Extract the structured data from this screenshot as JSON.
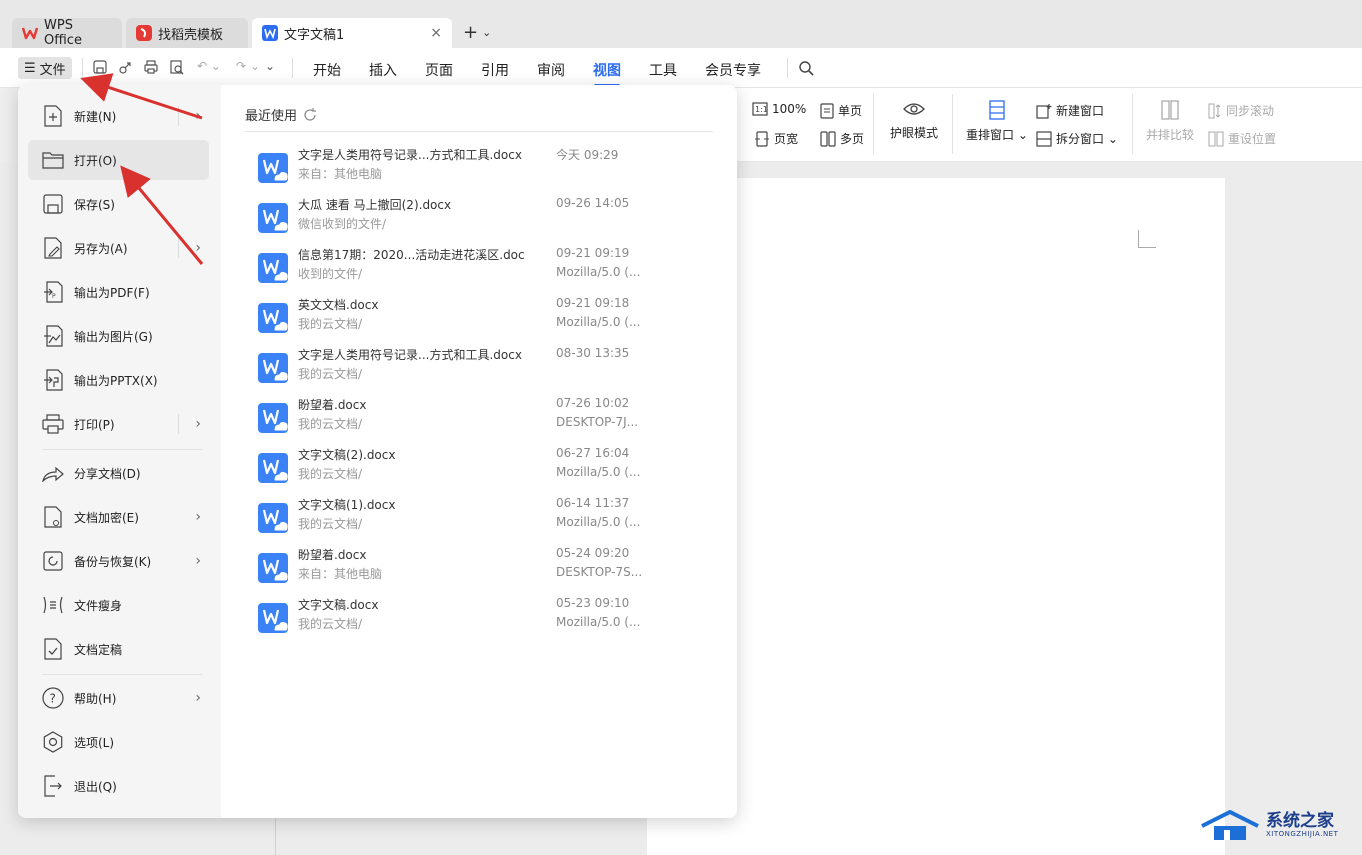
{
  "tabs": {
    "wps_label": "WPS Office",
    "template_label": "找稻壳模板",
    "doc_label": "文字文稿1",
    "close": "×",
    "add": "+"
  },
  "menubar": {
    "file_label": "文件",
    "items": [
      "开始",
      "插入",
      "页面",
      "引用",
      "审阅",
      "视图",
      "工具",
      "会员专享"
    ]
  },
  "ribbon": {
    "zoom100": "100%",
    "single_page": "单页",
    "page_width": "页宽",
    "multi_page": "多页",
    "eye_mode": "护眼模式",
    "rearrange": "重排窗口",
    "new_window": "新建窗口",
    "split_window": "拆分窗口",
    "side_by_side": "并排比较",
    "sync_scroll": "同步滚动",
    "reset_position": "重设位置"
  },
  "file_menu": {
    "items": [
      {
        "label": "新建(N)",
        "icon": "new-doc-icon"
      },
      {
        "label": "打开(O)",
        "icon": "folder-open-icon"
      },
      {
        "label": "保存(S)",
        "icon": "save-icon"
      },
      {
        "label": "另存为(A)",
        "icon": "save-as-icon"
      },
      {
        "label": "输出为PDF(F)",
        "icon": "export-pdf-icon"
      },
      {
        "label": "输出为图片(G)",
        "icon": "export-image-icon"
      },
      {
        "label": "输出为PPTX(X)",
        "icon": "export-pptx-icon"
      },
      {
        "label": "打印(P)",
        "icon": "print-icon"
      },
      {
        "label": "分享文档(D)",
        "icon": "share-icon"
      },
      {
        "label": "文档加密(E)",
        "icon": "encrypt-icon"
      },
      {
        "label": "备份与恢复(K)",
        "icon": "backup-icon"
      },
      {
        "label": "文件瘦身",
        "icon": "slim-icon"
      },
      {
        "label": "文档定稿",
        "icon": "finalize-icon"
      },
      {
        "label": "帮助(H)",
        "icon": "help-icon"
      },
      {
        "label": "选项(L)",
        "icon": "options-icon"
      },
      {
        "label": "退出(Q)",
        "icon": "exit-icon"
      }
    ],
    "recent_title": "最近使用",
    "recent_files": [
      {
        "name": "文字是人类用符号记录...方式和工具.docx",
        "source": "来自：其他电脑",
        "time": "今天 09:29",
        "device": ""
      },
      {
        "name": "大瓜 速看 马上撤回(2).docx",
        "source": "微信收到的文件/",
        "time": "09-26 14:05",
        "device": ""
      },
      {
        "name": "信息第17期：2020...活动走进花溪区.doc",
        "source": "收到的文件/",
        "time": "09-21 09:19",
        "device": "Mozilla/5.0 (..."
      },
      {
        "name": "英文文档.docx",
        "source": "我的云文档/",
        "time": "09-21 09:18",
        "device": "Mozilla/5.0 (..."
      },
      {
        "name": "文字是人类用符号记录...方式和工具.docx",
        "source": "我的云文档/",
        "time": "08-30 13:35",
        "device": ""
      },
      {
        "name": "盼望着.docx",
        "source": "我的云文档/",
        "time": "07-26 10:02",
        "device": "DESKTOP-7J..."
      },
      {
        "name": "文字文稿(2).docx",
        "source": "我的云文档/",
        "time": "06-27 16:04",
        "device": "Mozilla/5.0 (..."
      },
      {
        "name": "文字文稿(1).docx",
        "source": "我的云文档/",
        "time": "06-14 11:37",
        "device": "Mozilla/5.0 (..."
      },
      {
        "name": "盼望着.docx",
        "source": "来自：其他电脑",
        "time": "05-24 09:20",
        "device": "DESKTOP-7S..."
      },
      {
        "name": "文字文稿.docx",
        "source": "我的云文档/",
        "time": "05-23 09:10",
        "device": "Mozilla/5.0 (..."
      }
    ]
  },
  "watermark": {
    "title": "系统之家",
    "subtitle": "XITONGZHIJIA.NET"
  },
  "colors": {
    "accent": "#2c6cf0",
    "annotation_arrow": "#d9322e",
    "wps_red": "#e53935",
    "doc_icon_blue": "#3b82f6"
  }
}
